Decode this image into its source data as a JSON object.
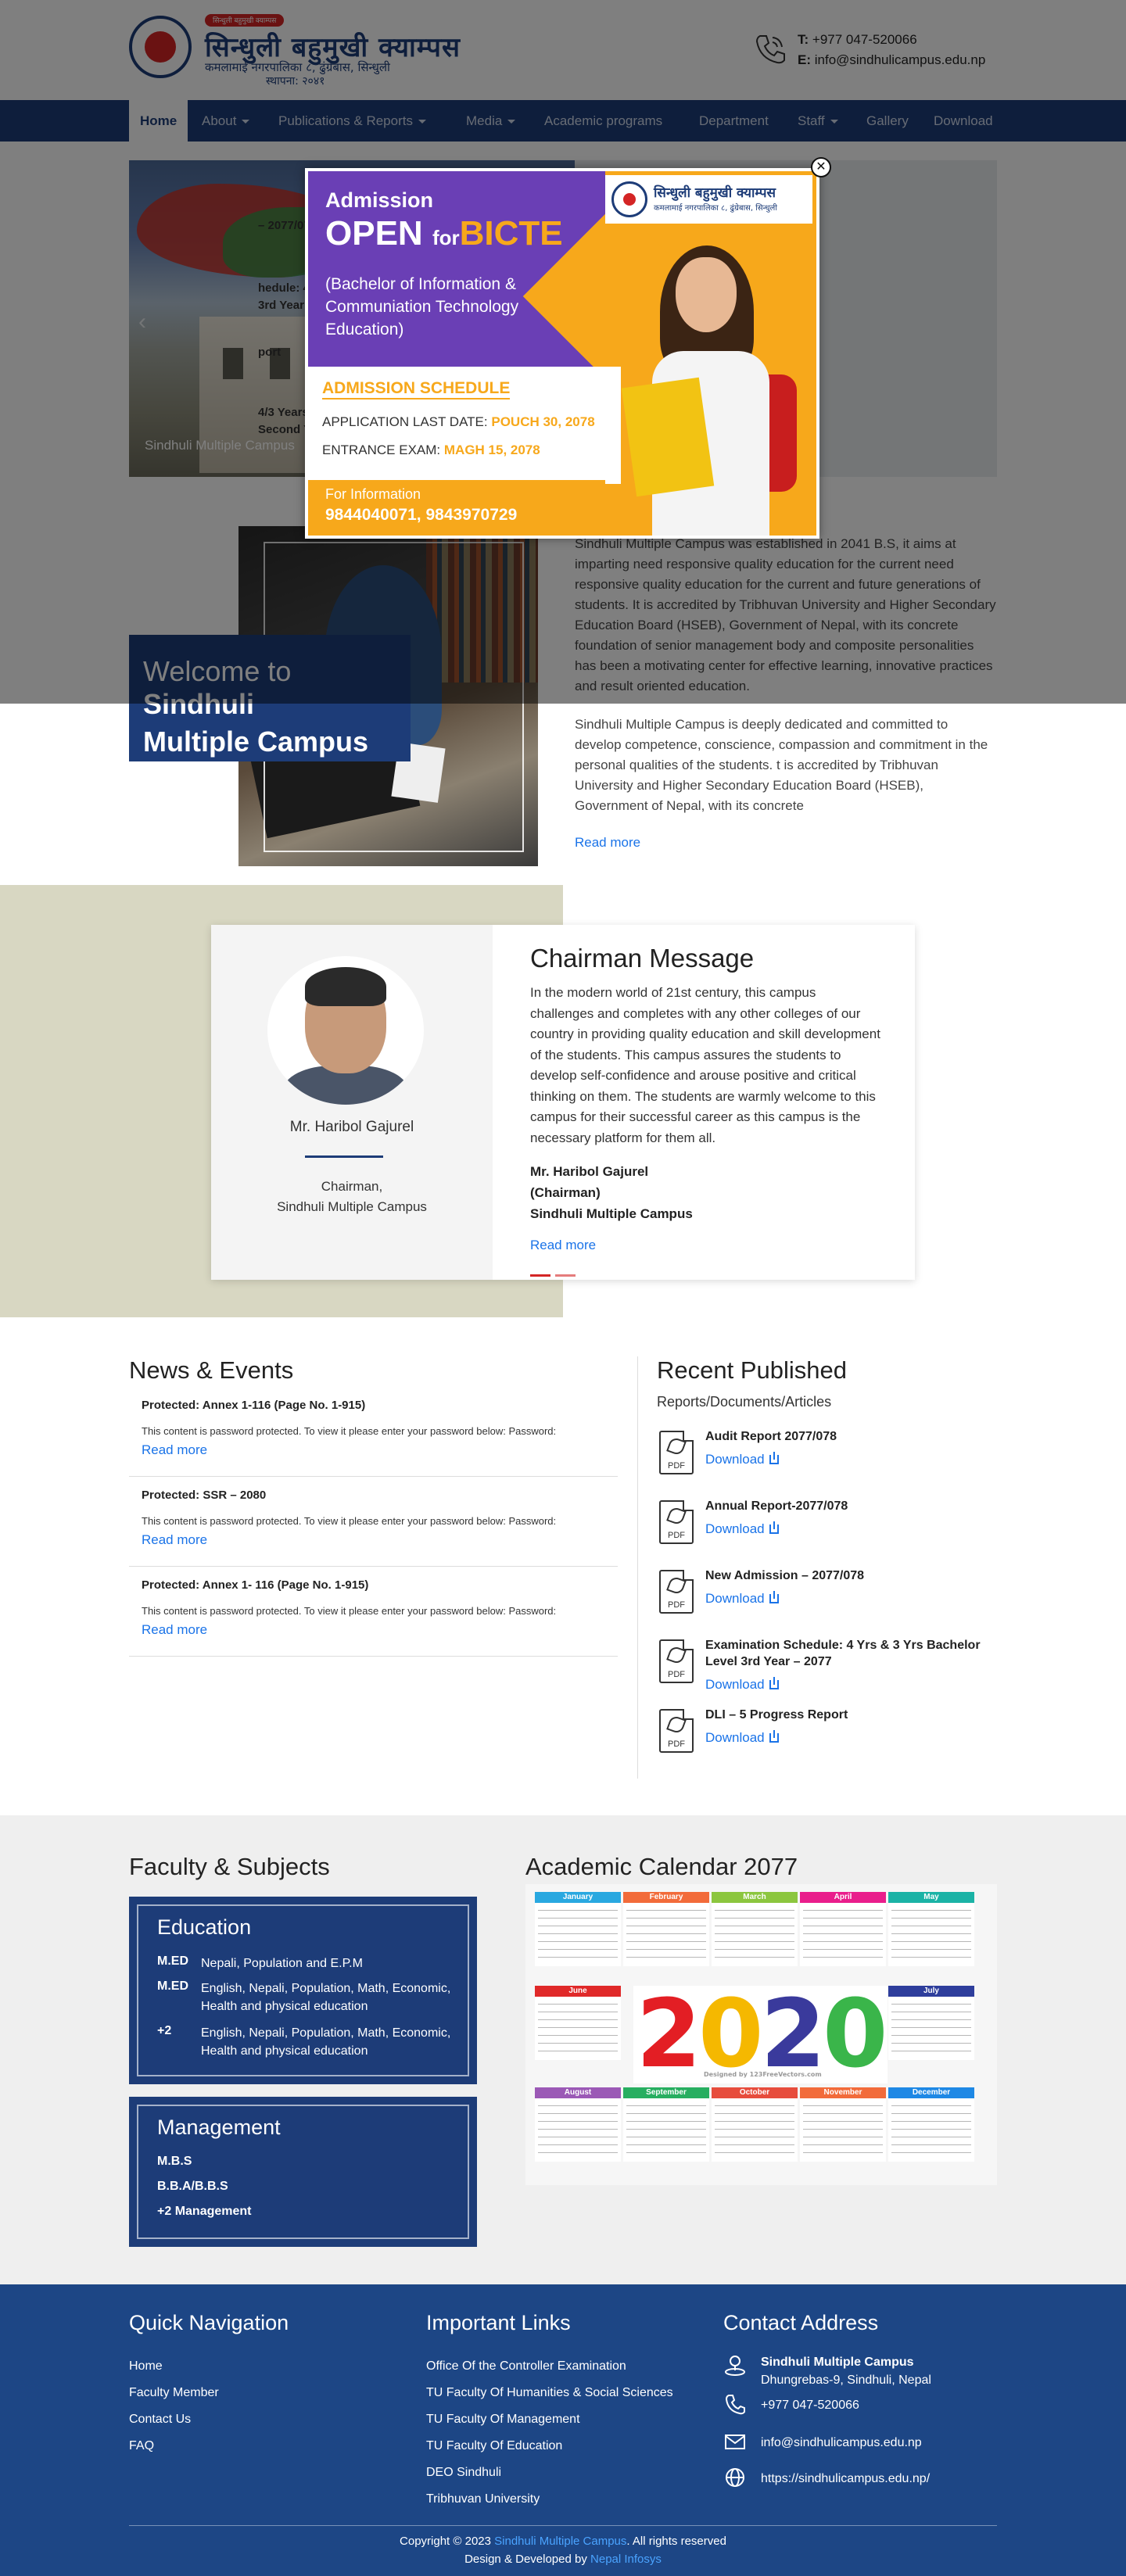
{
  "header": {
    "logo_banner": "सिन्धुली बहुमुखी क्याम्पस",
    "logo_title": "सिन्धुली बहुमुखी क्याम्पस",
    "logo_sub": "कमलामाई नगरपालिका ८, ढुंग्रेबास, सिन्धुली",
    "logo_est": "स्थापना: २०४१",
    "phone_label": "T:",
    "phone": "+977 047-520066",
    "email_label": "E:",
    "email": "info@sindhulicampus.edu.np"
  },
  "nav": {
    "items": [
      {
        "label": "Home"
      },
      {
        "label": "About"
      },
      {
        "label": "Publications & Reports"
      },
      {
        "label": "Media"
      },
      {
        "label": "Academic programs"
      },
      {
        "label": "Department"
      },
      {
        "label": "Staff"
      },
      {
        "label": "Gallery"
      },
      {
        "label": "Download"
      }
    ]
  },
  "slider": {
    "caption": "Sindhuli Multiple Campus",
    "side_items": [
      "– 2077/078",
      "hedule: 4 Yrs & 3 Yrs",
      "3rd Year – 2077",
      "port",
      "4/3 Years B.B.S, B.Ed,",
      "Second Year-2076"
    ]
  },
  "popup": {
    "admission": "Admission",
    "open": "OPEN",
    "for": "for",
    "program": "BICTE",
    "desc": "(Bachelor of Information & Communiation Technology Education)",
    "schedule_title": "ADMISSION SCHEDULE",
    "last_date_label": "APPLICATION LAST DATE:",
    "last_date": "POUCH 30, 2078",
    "exam_label": "ENTRANCE EXAM:",
    "exam_date": "MAGH 15, 2078",
    "info_label": "For Information",
    "phones": "9844040071, 9843970729",
    "logo_title": "सिन्धुली बहुमुखी क्याम्पस",
    "logo_sub": "कमलामाई नगरपालिका ८, ढुंग्रेबास, सिन्धुली",
    "close": "✕"
  },
  "about": {
    "welcome_prefix": "Welcome to ",
    "welcome_name_1": "Sindhuli",
    "welcome_name_2": "Multiple Campus",
    "para1": "Sindhuli Multiple Campus was established in 2041 B.S, it aims at imparting need responsive quality education for the current need responsive quality education for the current and future generations of students. It is accredited by Tribhuvan University and Higher Secondary Education Board (HSEB), Government of Nepal, with its concrete foundation of senior management body and composite personalities has been a motivating center for effective learning, innovative practices and result oriented education.",
    "para2": "Sindhuli Multiple Campus is deeply dedicated and committed to develop competence, conscience, compassion and commitment in the personal qualities of the students. t is accredited by Tribhuvan University and Higher Secondary Education Board (HSEB), Government of Nepal, with its concrete",
    "read_more": "Read more"
  },
  "chairman": {
    "name": "Mr. Haribol Gajurel",
    "role_1": "Chairman,",
    "role_2": "Sindhuli Multiple Campus",
    "heading": "Chairman Message",
    "message": "In the modern world of 21st century, this campus challenges and completes with any other colleges of our country in providing quality education and skill development of the students. This campus assures the students to develop self-confidence and arouse positive and critical thinking on them. The students are warmly welcome to this campus for their successful career as this campus is the necessary platform for them all.",
    "sign_1": "Mr. Haribol Gajurel",
    "sign_2": "(Chairman)",
    "sign_3": "Sindhuli Multiple Campus",
    "read_more": "Read more"
  },
  "news": {
    "heading": "News & Events",
    "items": [
      {
        "title": "Protected: Annex 1-116 (Page No. 1-915)",
        "body": "This content is password protected. To view it please enter your password below: Password:",
        "more": "Read more"
      },
      {
        "title": "Protected: SSR – 2080",
        "body": "This content is password protected. To view it please enter your password below: Password:",
        "more": "Read more"
      },
      {
        "title": "Protected: Annex 1- 116 (Page No. 1-915)",
        "body": "This content is password protected. To view it please enter your password below: Password:",
        "more": "Read more"
      }
    ]
  },
  "published": {
    "heading": "Recent Published",
    "sub": "Reports/Documents/Articles",
    "pdf_label": "PDF",
    "items": [
      {
        "title": "Audit Report 2077/078",
        "dl": "Download"
      },
      {
        "title": "Annual Report-2077/078",
        "dl": "Download"
      },
      {
        "title": "New Admission – 2077/078",
        "dl": "Download"
      },
      {
        "title": "Examination Schedule: 4 Yrs & 3 Yrs Bachelor Level 3rd Year – 2077",
        "dl": "Download"
      },
      {
        "title": "DLI – 5 Progress Report",
        "dl": "Download"
      }
    ]
  },
  "faculty": {
    "heading": "Faculty & Subjects",
    "education": {
      "title": "Education",
      "rows": [
        {
          "code": "M.ED",
          "subjects": "Nepali, Population and E.P.M"
        },
        {
          "code": "M.ED",
          "subjects": "English, Nepali, Population, Math, Economic, Health and physical education"
        },
        {
          "code": "+2",
          "subjects": "English, Nepali, Population, Math, Economic, Health and physical education"
        }
      ]
    },
    "management": {
      "title": "Management",
      "items": [
        "M.B.S",
        "B.B.A/B.B.S",
        "+2 Management"
      ]
    }
  },
  "calendar": {
    "heading": "Academic Calendar 2077",
    "year_digits": [
      "2",
      "0",
      "2",
      "0"
    ],
    "credit": "Designed by 123FreeVectors.com",
    "months": [
      {
        "name": "January",
        "color": "#29a8e0"
      },
      {
        "name": "February",
        "color": "#f26b3a"
      },
      {
        "name": "March",
        "color": "#8cc63f"
      },
      {
        "name": "April",
        "color": "#e91e8c"
      },
      {
        "name": "May",
        "color": "#1bb3a6"
      },
      {
        "name": "June",
        "color": "#e02929"
      },
      {
        "name": "July",
        "color": "#2e3e9c"
      },
      {
        "name": "August",
        "color": "#9b59b6"
      },
      {
        "name": "September",
        "color": "#27ae60"
      },
      {
        "name": "October",
        "color": "#e74c3c"
      },
      {
        "name": "November",
        "color": "#f26b3a"
      },
      {
        "name": "December",
        "color": "#1e88e5"
      }
    ]
  },
  "footer": {
    "nav_heading": "Quick Navigation",
    "nav_links": [
      "Home",
      "Faculty Member",
      "Contact Us",
      "FAQ"
    ],
    "links_heading": "Important Links",
    "links": [
      "Office Of the Controller Examination",
      "TU Faculty Of Humanities & Social Sciences",
      "TU Faculty Of Management",
      "TU Faculty Of Education",
      "DEO Sindhuli",
      "Tribhuvan University"
    ],
    "contact_heading": "Contact Address",
    "campus": "Sindhuli Multiple Campus",
    "address": "Dhungrebas-9, Sindhuli, Nepal",
    "phone": "+977 047-520066",
    "email": "info@sindhulicampus.edu.np",
    "website": "https://sindhulicampus.edu.np/",
    "copy_prefix": "Copyright © 2023 ",
    "copy_link": "Sindhuli Multiple Campus",
    "copy_suffix": ". All rights reserved",
    "dev_prefix": "Design & Developed by ",
    "dev_link": "Nepal Infosys"
  }
}
